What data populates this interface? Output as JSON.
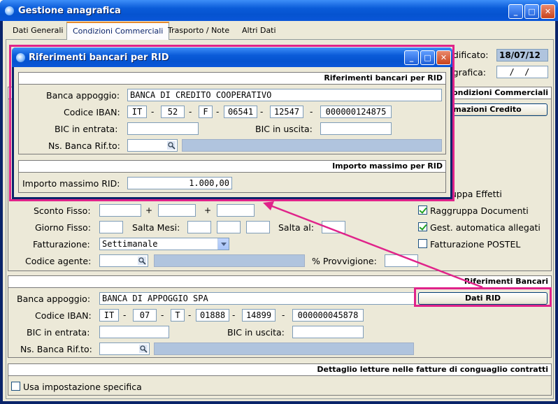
{
  "window": {
    "title": "Gestione anagrafica"
  },
  "tabs": [
    "Dati Generali",
    "Condizioni Commerciali",
    "Trasporto / Note",
    "Altri Dati"
  ],
  "header_right": {
    "modificato_label": "ndificato:",
    "modificato_value": "18/07/12",
    "anagrafica_label": "agrafica:",
    "anagrafica_value": "  /  /"
  },
  "cond_section": {
    "title": "/Condizioni Commerciali",
    "info_button": "ormazioni Credito"
  },
  "main": {
    "raggruppa_effetti": "uppa Effetti",
    "sconto_fisso_label": "Sconto Fisso:",
    "plus": "+",
    "giorno_fisso_label": "Giorno Fisso:",
    "salta_mesi_label": "Salta Mesi:",
    "salta_al_label": "Salta al:",
    "fatturazione_label": "Fatturazione:",
    "fatturazione_value": "Settimanale",
    "codice_agente_label": "Codice agente:",
    "provvigione_label": "% Provvigione:",
    "raggruppa_documenti": "Raggruppa Documenti",
    "gest_allegati": "Gest. automatica allegati",
    "fatturazione_postel": "Fatturazione POSTEL"
  },
  "bank": {
    "section_title": "Riferimenti Bancari",
    "banca_label": "Banca appoggio:",
    "banca_value": "BANCA DI APPOGGIO SPA",
    "dati_rid_button": "Dati RID",
    "iban_label": "Codice IBAN:",
    "iban": [
      "IT",
      "07",
      "T",
      "01888",
      "14899",
      "000000045878"
    ],
    "bic_in_label": "BIC in entrata:",
    "bic_out_label": "BIC in uscita:",
    "ns_banca_label": "Ns. Banca Rif.to:"
  },
  "letture": {
    "section_title": "Dettaglio letture nelle fatture di conguaglio contratti",
    "usa_label": "Usa impostazione specifica"
  },
  "dialog": {
    "title": "Riferimenti bancari per RID",
    "section1_title": "Riferimenti bancari per RID",
    "banca_label": "Banca appoggio:",
    "banca_value": "BANCA DI CREDITO COOPERATIVO",
    "iban_label": "Codice IBAN:",
    "iban": [
      "IT",
      "52",
      "F",
      "06541",
      "12547",
      "000000124875"
    ],
    "bic_in_label": "BIC in entrata:",
    "bic_out_label": "BIC in uscita:",
    "ns_banca_label": "Ns. Banca Rif.to:",
    "section2_title": "Importo massimo per RID",
    "importo_label": "Importo massimo RID:",
    "importo_value": "1.000,00"
  },
  "dash": "-",
  "colors": {
    "highlight": "#e0238a",
    "title_blue": "#0a5bd8",
    "readonly_field": "#b0c4de"
  }
}
